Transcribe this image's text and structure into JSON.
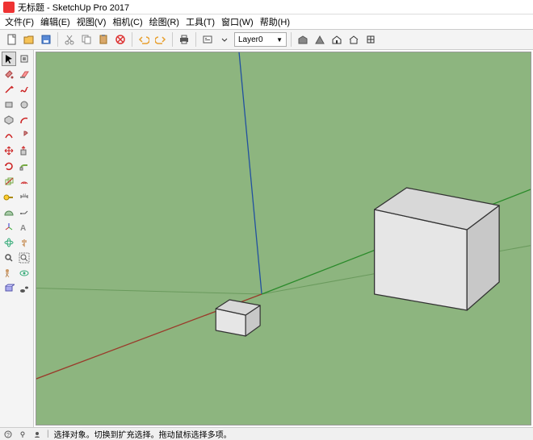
{
  "app": {
    "title": "无标题 - SketchUp Pro 2017"
  },
  "menu": {
    "file": "文件(F)",
    "edit": "编辑(E)",
    "view": "视图(V)",
    "camera": "相机(C)",
    "draw": "绘图(R)",
    "tools": "工具(T)",
    "window": "窗口(W)",
    "help": "帮助(H)"
  },
  "layer": {
    "current": "Layer0"
  },
  "status": {
    "tip": "选择对象。切换到扩充选择。拖动鼠标选择多项。"
  }
}
